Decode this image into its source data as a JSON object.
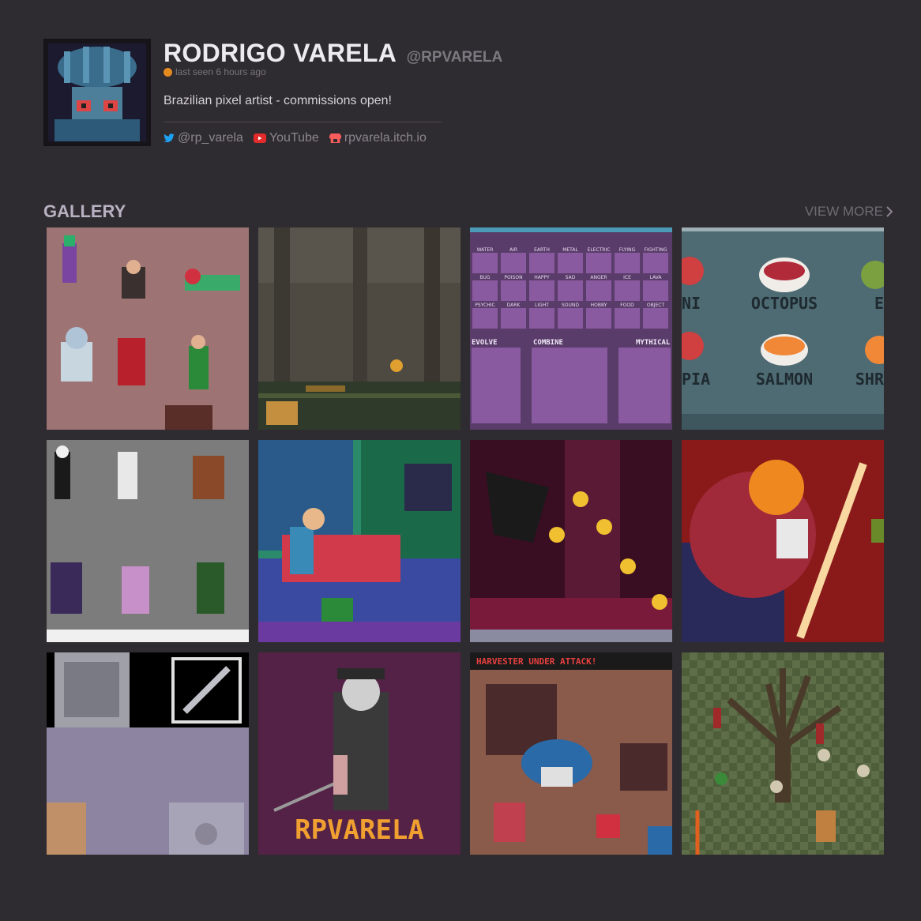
{
  "profile": {
    "display_name": "RODRIGO VARELA",
    "handle": "@RPVARELA",
    "last_seen": "last seen 6 hours ago",
    "bio": "Brazilian pixel artist - commissions open!",
    "links": [
      {
        "label": "@rp_varela",
        "icon": "twitter-icon"
      },
      {
        "label": "YouTube",
        "icon": "youtube-icon"
      },
      {
        "label": "rpvarela.itch.io",
        "icon": "itchio-icon"
      }
    ]
  },
  "gallery": {
    "title": "GALLERY",
    "view_more": "VIEW MORE",
    "tiles": [
      {
        "caption": ""
      },
      {
        "caption": ""
      },
      {
        "labels": [
          "WATER",
          "AIR",
          "EARTH",
          "METAL",
          "ELECTRIC",
          "FLYING",
          "FIGHTING",
          "BUG",
          "POISON",
          "HAPPY",
          "SAD",
          "ANGER",
          "ICE",
          "LAVA",
          "PSYCHIC",
          "DARK",
          "LIGHT",
          "SOUND",
          "HOBBY",
          "FOOD",
          "OBJECT"
        ],
        "sections": [
          "EVOLVE",
          "COMBINE",
          "MYTHICAL"
        ]
      },
      {
        "labels": [
          "NI",
          "OCTOPUS",
          "E",
          "PIA",
          "SALMON",
          "SHR"
        ]
      },
      {
        "caption": ""
      },
      {
        "caption": ""
      },
      {
        "caption": ""
      },
      {
        "caption": ""
      },
      {
        "caption": ""
      },
      {
        "logo_text": "RPVARELA"
      },
      {
        "banner": "HARVESTER UNDER ATTACK!"
      },
      {
        "caption": ""
      }
    ]
  },
  "colors": {
    "background": "#2f2c31",
    "status": "#e58a1f",
    "accent_twitter": "#1da1f2",
    "accent_youtube": "#ff0000",
    "accent_itch": "#fa5c5c"
  }
}
